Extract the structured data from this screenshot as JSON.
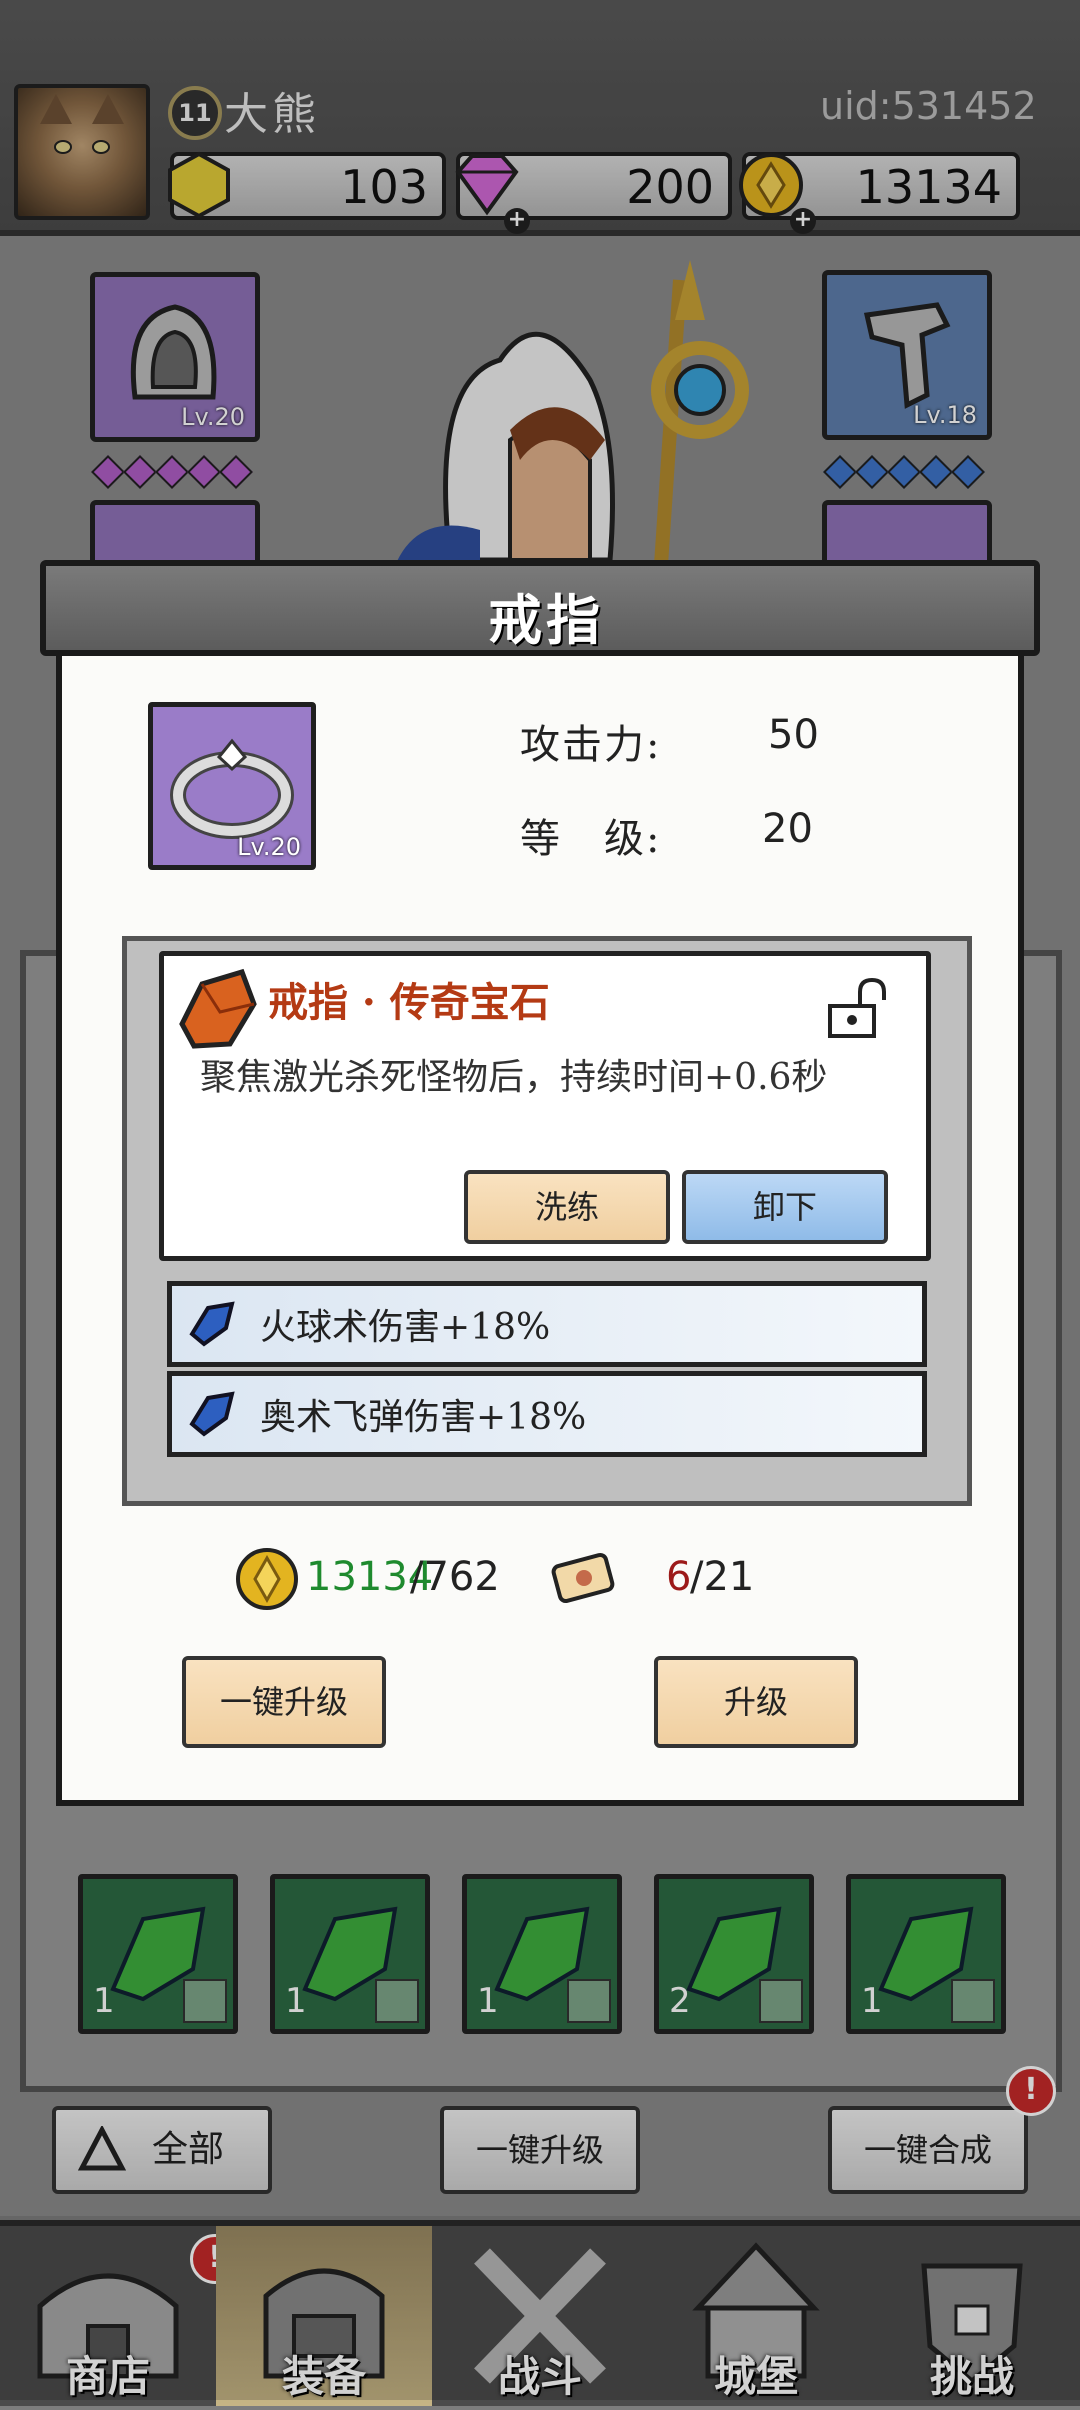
{
  "player": {
    "level": "11",
    "name": "大熊",
    "uid": "uid:531452"
  },
  "resources": [
    {
      "name": "gold-gem",
      "value": "103",
      "color": "#e2cc3a"
    },
    {
      "name": "diamond",
      "value": "200",
      "color": "#d26ad6"
    },
    {
      "name": "coin",
      "value": "13134",
      "color": "#e3b420"
    }
  ],
  "equipment": {
    "left_top_level": "Lv.20",
    "right_top_level": "Lv.18"
  },
  "gem_grid": [
    {
      "count": "1"
    },
    {
      "count": "1"
    },
    {
      "count": "1"
    },
    {
      "count": "2"
    },
    {
      "count": "1"
    }
  ],
  "toolbar": {
    "filter_label": "全部",
    "upgrade_all_label": "一键升级",
    "merge_all_label": "一键合成"
  },
  "nav": [
    {
      "label": "商店",
      "alert": "!"
    },
    {
      "label": "装备",
      "active": true
    },
    {
      "label": "战斗"
    },
    {
      "label": "城堡"
    },
    {
      "label": "挑战"
    }
  ],
  "merge_alert": "!",
  "dialog": {
    "title": "戒指",
    "item_level": "Lv.20",
    "attack_label": "攻击力:",
    "attack_value": "50",
    "level_label": "等　级:",
    "level_value": "20",
    "gem": {
      "title": "戒指 · 传奇宝石",
      "description": "聚焦激光杀死怪物后，持续时间+0.6秒",
      "reforge_label": "洗练",
      "unequip_label": "卸下"
    },
    "affixes": [
      {
        "text": "火球术伤害+18%"
      },
      {
        "text": "奥术飞弹伤害+18%"
      }
    ],
    "cost": {
      "coin_have": "13134",
      "coin_need": "/762",
      "scroll_have": "6",
      "scroll_need": "/21"
    },
    "upgrade_all_label": "一键升级",
    "upgrade_label": "升级"
  },
  "colors": {
    "coin_have": "#1e8a2e",
    "scroll_have": "#9c1a1a",
    "gem_title": "#b43a14"
  }
}
